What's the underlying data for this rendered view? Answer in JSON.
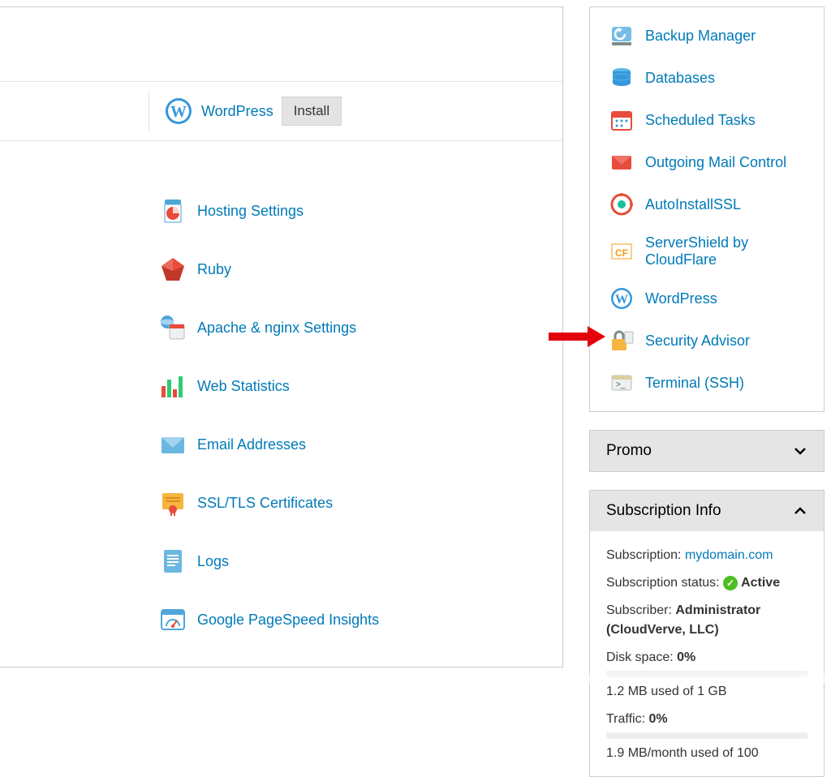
{
  "wordpress": {
    "label": "WordPress",
    "install_label": "Install"
  },
  "tools": [
    {
      "label": "Hosting Settings",
      "icon": "hosting"
    },
    {
      "label": "Ruby",
      "icon": "ruby"
    },
    {
      "label": "Apache & nginx Settings",
      "icon": "serversettings"
    },
    {
      "label": "Web Statistics",
      "icon": "stats"
    },
    {
      "label": "Email Addresses",
      "icon": "mail"
    },
    {
      "label": "SSL/TLS Certificates",
      "icon": "cert"
    },
    {
      "label": "Logs",
      "icon": "logs"
    },
    {
      "label": "Google PageSpeed Insights",
      "icon": "pagespeed"
    }
  ],
  "side_tools": [
    {
      "label": "Backup Manager",
      "icon": "backup"
    },
    {
      "label": "Databases",
      "icon": "db"
    },
    {
      "label": "Scheduled Tasks",
      "icon": "calendar"
    },
    {
      "label": "Outgoing Mail Control",
      "icon": "mailred"
    },
    {
      "label": "AutoInstallSSL",
      "icon": "autossl"
    },
    {
      "label": "ServerShield by CloudFlare",
      "icon": "cloudflare"
    },
    {
      "label": "WordPress",
      "icon": "wordpress"
    },
    {
      "label": "Security Advisor",
      "icon": "security"
    },
    {
      "label": "Terminal (SSH)",
      "icon": "terminal"
    }
  ],
  "promo": {
    "title": "Promo"
  },
  "sub": {
    "title": "Subscription Info",
    "subscription_label": "Subscription: ",
    "subscription_value": "mydomain.com",
    "status_label": "Subscription status: ",
    "status_value": "Active",
    "subscriber_label": "Subscriber: ",
    "subscriber_value": "Administrator (CloudVerve, LLC)",
    "disk_label": "Disk space: ",
    "disk_pct": "0%",
    "disk_used": "1.2 MB used of 1 GB",
    "traffic_label": "Traffic: ",
    "traffic_pct": "0%",
    "traffic_used": "1.9 MB/month used of 100"
  }
}
